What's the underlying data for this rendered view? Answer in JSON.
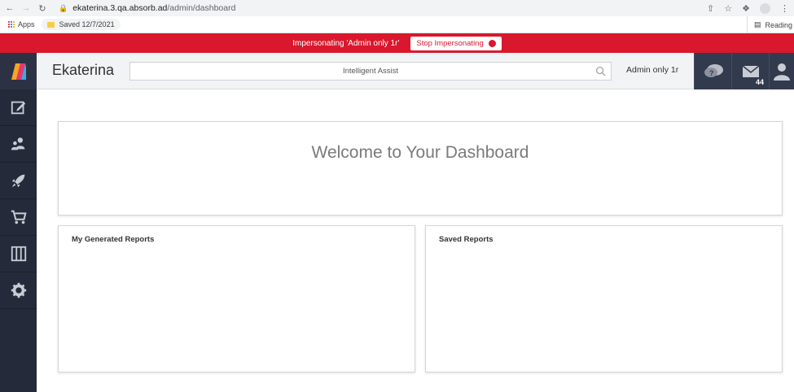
{
  "browser": {
    "url_host": "ekaterina.3.qa.absorb.ad",
    "url_path": "/admin/dashboard",
    "bookmarks": {
      "apps_label": "Apps",
      "saved_label": "Saved 12/7/2021",
      "reading_list_label": "Reading list"
    }
  },
  "banner": {
    "message": "Impersonating 'Admin only 1r'",
    "stop_label": "Stop Impersonating"
  },
  "header": {
    "brand": "Ekaterina",
    "search_placeholder": "Intelligent Assist",
    "user_name": "Admin only 1r",
    "message_count": "44"
  },
  "sidebar": {
    "items": [
      "edit",
      "users",
      "rocket",
      "cart",
      "columns",
      "settings"
    ]
  },
  "main": {
    "welcome_title": "Welcome to Your Dashboard",
    "reports": [
      {
        "title": "My Generated Reports"
      },
      {
        "title": "Saved Reports"
      }
    ]
  },
  "colors": {
    "banner": "#d9182d",
    "sidebar": "#252a3a",
    "header_buttons": "#323a4d"
  }
}
